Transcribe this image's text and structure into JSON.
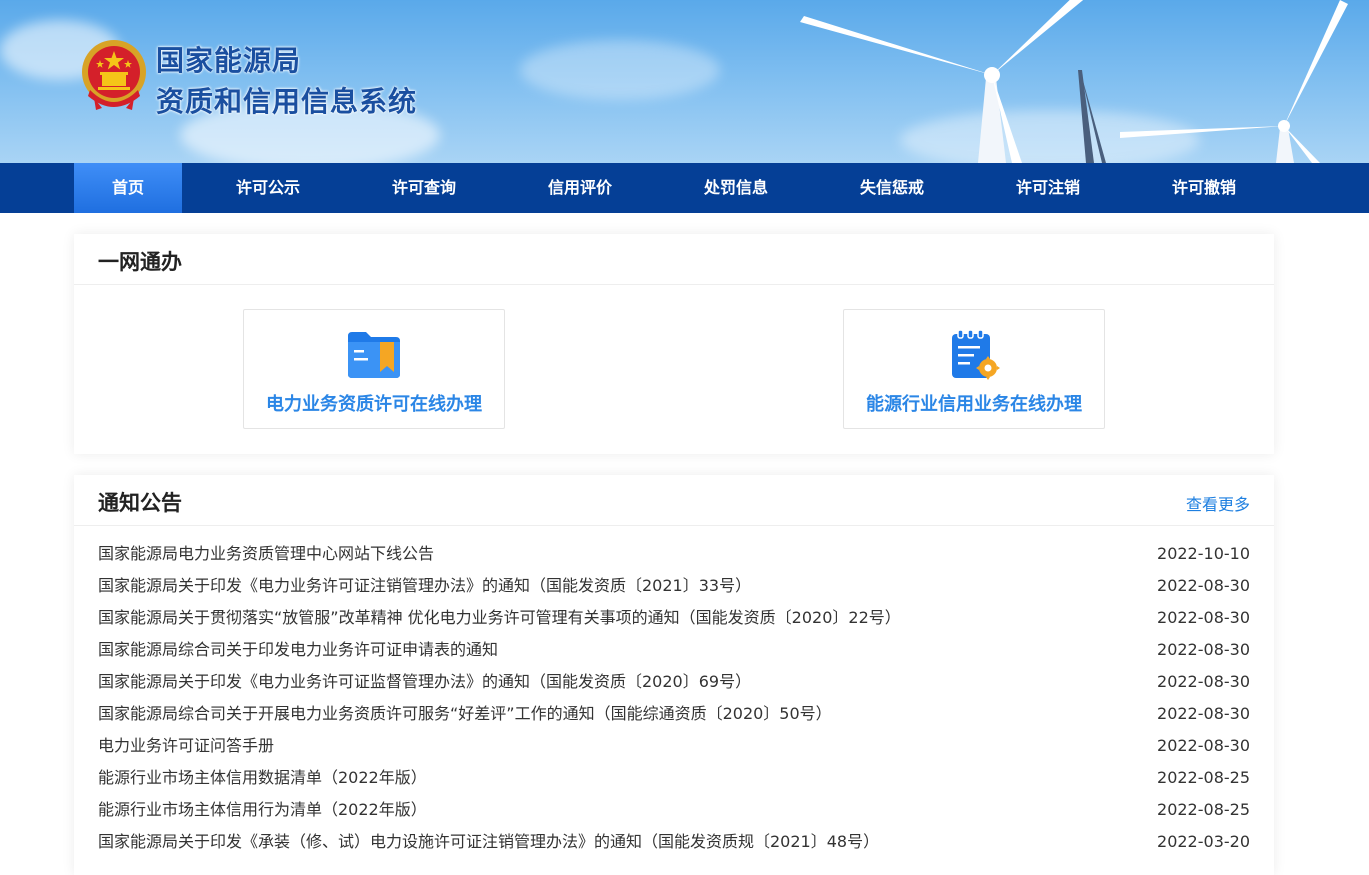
{
  "header": {
    "org_name": "国家能源局",
    "system_name": "资质和信用信息系统"
  },
  "nav": {
    "items": [
      {
        "label": "首页",
        "active": true
      },
      {
        "label": "许可公示"
      },
      {
        "label": "许可查询"
      },
      {
        "label": "信用评价"
      },
      {
        "label": "处罚信息"
      },
      {
        "label": "失信惩戒"
      },
      {
        "label": "许可注销"
      },
      {
        "label": "许可撤销"
      }
    ]
  },
  "one_stop": {
    "title": "一网通办",
    "services": [
      {
        "label": "电力业务资质许可在线办理",
        "icon": "folder-bookmark-icon"
      },
      {
        "label": "能源行业信用业务在线办理",
        "icon": "document-gear-icon"
      }
    ]
  },
  "notices": {
    "title": "通知公告",
    "more_label": "查看更多",
    "items": [
      {
        "title": "国家能源局电力业务资质管理中心网站下线公告",
        "date": "2022-10-10"
      },
      {
        "title": "国家能源局关于印发《电力业务许可证注销管理办法》的通知（国能发资质〔2021〕33号）",
        "date": "2022-08-30"
      },
      {
        "title": "国家能源局关于贯彻落实“放管服”改革精神 优化电力业务许可管理有关事项的通知（国能发资质〔2020〕22号）",
        "date": "2022-08-30"
      },
      {
        "title": "国家能源局综合司关于印发电力业务许可证申请表的通知",
        "date": "2022-08-30"
      },
      {
        "title": "国家能源局关于印发《电力业务许可证监督管理办法》的通知（国能发资质〔2020〕69号）",
        "date": "2022-08-30"
      },
      {
        "title": "国家能源局综合司关于开展电力业务资质许可服务“好差评”工作的通知（国能综通资质〔2020〕50号）",
        "date": "2022-08-30"
      },
      {
        "title": "电力业务许可证问答手册",
        "date": "2022-08-30"
      },
      {
        "title": "能源行业市场主体信用数据清单（2022年版）",
        "date": "2022-08-25"
      },
      {
        "title": "能源行业市场主体信用行为清单（2022年版）",
        "date": "2022-08-25"
      },
      {
        "title": "国家能源局关于印发《承装（修、试）电力设施许可证注销管理办法》的通知（国能发资质规〔2021〕48号）",
        "date": "2022-03-20"
      }
    ]
  },
  "colors": {
    "nav_bg": "#053f96",
    "nav_active": "#2f7ff0",
    "link_blue": "#1e7fe0",
    "service_label": "#2b86e6"
  }
}
